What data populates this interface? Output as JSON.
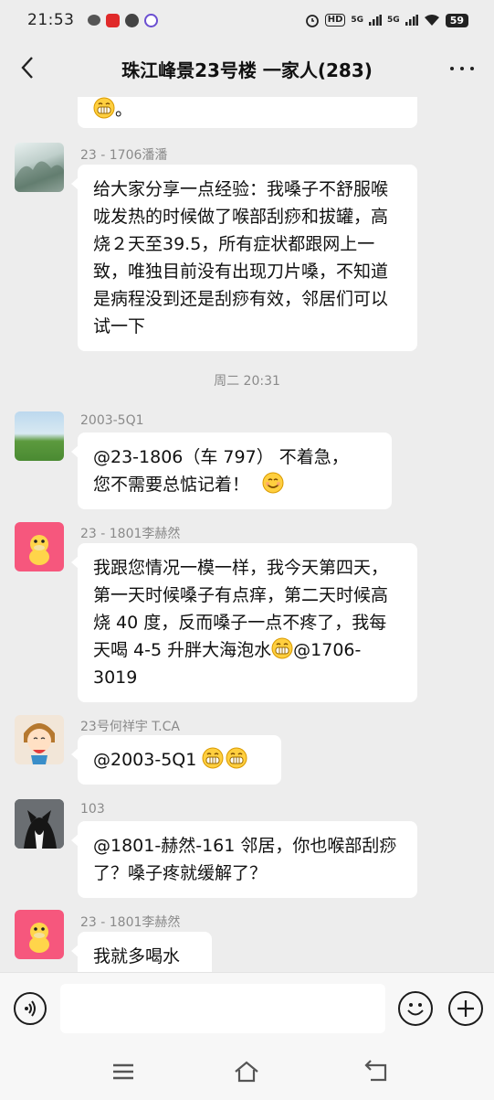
{
  "status_bar": {
    "time": "21:53",
    "hd": "HD",
    "signal1": "5G",
    "signal2": "5G",
    "battery": "59"
  },
  "header": {
    "title": "珠江峰景23号楼  一家人(283)",
    "back_icon": "chevron-left-icon",
    "more_icon": "more-dots-icon"
  },
  "messages": [
    {
      "sender": "",
      "text": "。",
      "emoji_before": "grin-emoji"
    },
    {
      "sender": "23 - 1706潘潘",
      "text": "给大家分享一点经验：我嗓子不舒服喉咙发热的时候做了喉部刮痧和拔罐，高烧２天至39.5，所有症状都跟网上一致，唯独目前没有出现刀片嗓，不知道是病程没到还是刮痧有效，邻居们可以试一下"
    },
    {
      "timestamp": "周二 20:31"
    },
    {
      "sender": "2003-5Q1",
      "text_line1": "@23-1806（车 797） 不着急，",
      "text_line2": "您不需要总惦记着！",
      "emoji_after": "smile-emoji"
    },
    {
      "sender": "23 - 1801李赫然",
      "text": "我跟您情况一模一样，我今天第四天，第一天时候嗓子有点痒，第二天时候高烧 40 度，反而嗓子一点不疼了，我每天喝 4-5 升胖大海泡",
      "text_tail_before": "水",
      "text_tail_after": "@1706-3019",
      "emoji_mid": "grin-emoji"
    },
    {
      "sender": "23号何祥宇 T.CA",
      "text": "@2003-5Q1 ",
      "emoji_after": "grin-emoji x2"
    },
    {
      "sender": "103",
      "text": "@1801-赫然-161 邻居，你也喉部刮痧了？嗓子疼就缓解了？"
    },
    {
      "sender": "23 - 1801李赫然",
      "text": "我就多喝水"
    }
  ],
  "input_bar": {
    "voice_icon": "voice-icon",
    "placeholder": "",
    "emoji_icon": "emoji-icon",
    "plus_icon": "plus-icon"
  },
  "system_nav": {
    "menu_icon": "menu-icon",
    "home_icon": "home-icon",
    "back_icon": "back-icon"
  }
}
